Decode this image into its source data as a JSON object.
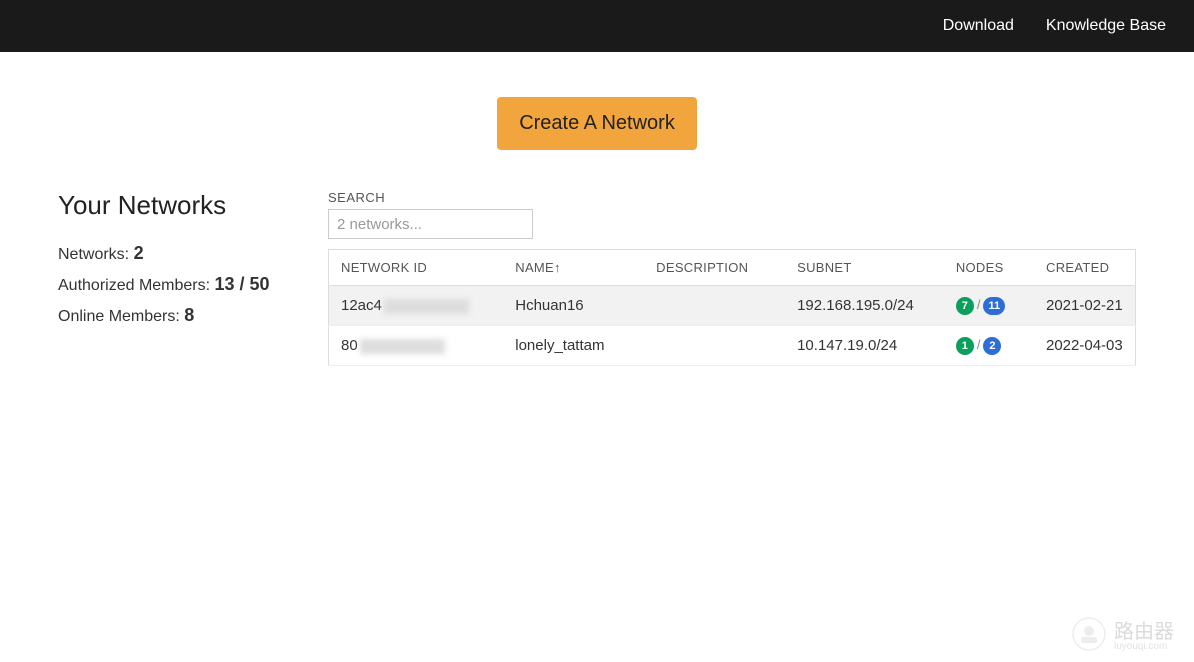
{
  "nav": {
    "download": "Download",
    "knowledge_base": "Knowledge Base"
  },
  "create_button": "Create A Network",
  "sidebar": {
    "title": "Your Networks",
    "networks_label": "Networks: ",
    "networks_value": "2",
    "authorized_label": "Authorized Members: ",
    "authorized_value": "13 / 50",
    "online_label": "Online Members: ",
    "online_value": "8"
  },
  "search": {
    "label": "SEARCH",
    "placeholder": "2 networks..."
  },
  "table": {
    "headers": {
      "network_id": "NETWORK ID",
      "name": "NAME↑",
      "description": "DESCRIPTION",
      "subnet": "SUBNET",
      "nodes": "NODES",
      "created": "CREATED"
    },
    "rows": [
      {
        "network_id_prefix": "12ac4",
        "name": "Hchuan16",
        "description": "",
        "subnet": "192.168.195.0/24",
        "nodes_online": "7",
        "nodes_total": "11",
        "created": "2021-02-21"
      },
      {
        "network_id_prefix": "80",
        "name": "lonely_tattam",
        "description": "",
        "subnet": "10.147.19.0/24",
        "nodes_online": "1",
        "nodes_total": "2",
        "created": "2022-04-03"
      }
    ]
  },
  "watermark": {
    "cn": "路由器",
    "en": "luyouqi.com"
  }
}
